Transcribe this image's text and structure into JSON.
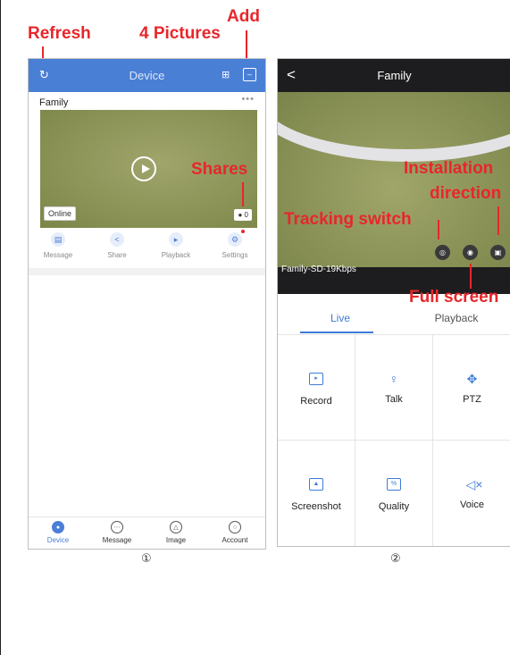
{
  "callouts": {
    "refresh": "Refresh",
    "pictures": "4 Pictures",
    "add": "Add",
    "shares": "Shares",
    "installation": "Installation",
    "direction": "direction",
    "tracking": "Tracking switch",
    "fullscreen": "Full screen"
  },
  "callout_color": "#e8262b",
  "screen1": {
    "header": {
      "title": "Device",
      "color": "#4a7fd6",
      "icons": [
        "refresh-icon",
        "grid-4-icon",
        "add-scan-icon"
      ]
    },
    "device": {
      "name": "Family",
      "more": "•••",
      "status": "Online",
      "shares": "0",
      "actions": [
        {
          "label": "Message",
          "icon": "message-icon"
        },
        {
          "label": "Share",
          "icon": "share-icon"
        },
        {
          "label": "Playback",
          "icon": "playback-icon"
        },
        {
          "label": "Settings",
          "icon": "settings-icon"
        }
      ]
    },
    "nav": [
      {
        "label": "Device",
        "icon": "device-icon",
        "active": true
      },
      {
        "label": "Message",
        "icon": "message-icon"
      },
      {
        "label": "Image",
        "icon": "image-icon"
      },
      {
        "label": "Account",
        "icon": "account-icon"
      }
    ]
  },
  "screen2": {
    "header": {
      "title": "Family",
      "back": "<"
    },
    "stream_label": "Family-SD-19Kbps",
    "tabs": [
      {
        "label": "Live",
        "active": true
      },
      {
        "label": "Playback"
      }
    ],
    "controls": [
      {
        "label": "Record",
        "icon": "record-icon"
      },
      {
        "label": "Talk",
        "icon": "microphone-icon"
      },
      {
        "label": "PTZ",
        "icon": "ptz-icon"
      },
      {
        "label": "Screenshot",
        "icon": "screenshot-icon"
      },
      {
        "label": "Quality",
        "icon": "quality-icon"
      },
      {
        "label": "Voice",
        "icon": "speaker-mute-icon"
      }
    ]
  },
  "footer": {
    "marker1": "①",
    "marker2": "②"
  }
}
